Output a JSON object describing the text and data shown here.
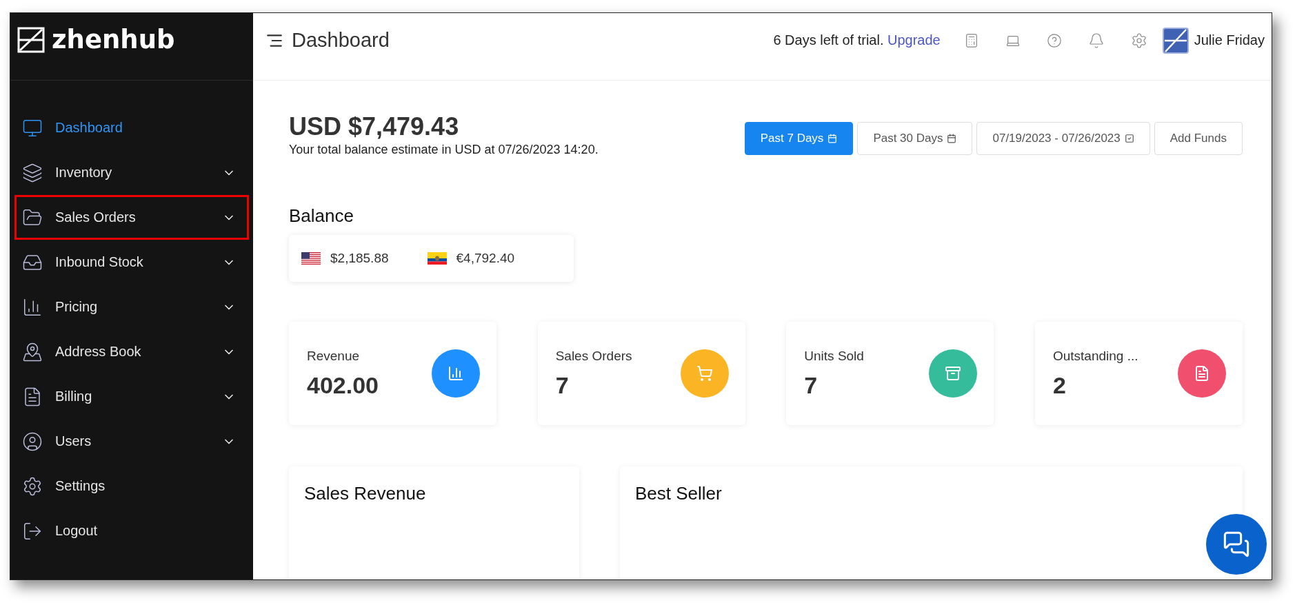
{
  "sidebar": {
    "logo": "zhenhub",
    "items": [
      {
        "label": "Dashboard",
        "selected": true,
        "expandable": false,
        "highlighted": false
      },
      {
        "label": "Inventory",
        "selected": false,
        "expandable": true,
        "highlighted": false
      },
      {
        "label": "Sales Orders",
        "selected": false,
        "expandable": true,
        "highlighted": true
      },
      {
        "label": "Inbound Stock",
        "selected": false,
        "expandable": true,
        "highlighted": false
      },
      {
        "label": "Pricing",
        "selected": false,
        "expandable": true,
        "highlighted": false
      },
      {
        "label": "Address Book",
        "selected": false,
        "expandable": true,
        "highlighted": false
      },
      {
        "label": "Billing",
        "selected": false,
        "expandable": true,
        "highlighted": false
      },
      {
        "label": "Users",
        "selected": false,
        "expandable": true,
        "highlighted": false
      },
      {
        "label": "Settings",
        "selected": false,
        "expandable": false,
        "highlighted": false
      },
      {
        "label": "Logout",
        "selected": false,
        "expandable": false,
        "highlighted": false
      }
    ]
  },
  "header": {
    "title": "Dashboard",
    "trial_text": "6 Days left of trial.",
    "upgrade_link": "Upgrade",
    "user_name": "Julie Friday"
  },
  "summary": {
    "amount": "USD $7,479.43",
    "note": "Your total balance estimate in USD at 07/26/2023 14:20."
  },
  "range_buttons": [
    {
      "label": "Past 7 Days",
      "selected": true,
      "kind": "calendar"
    },
    {
      "label": "Past 30 Days",
      "selected": false,
      "kind": "calendar"
    },
    {
      "label": "07/19/2023 - 07/26/2023",
      "selected": false,
      "kind": "check"
    },
    {
      "label": "Add Funds",
      "selected": false,
      "kind": "plain"
    }
  ],
  "balance": {
    "title": "Balance",
    "entries": [
      {
        "amount": "$2,185.88",
        "kind": "us"
      },
      {
        "amount": "€4,792.40",
        "kind": "ec"
      }
    ]
  },
  "stats": [
    {
      "label": "Revenue",
      "value": "402.00",
      "color": "#1e90ff",
      "kind": "chart"
    },
    {
      "label": "Sales Orders",
      "value": "7",
      "color": "#fbb424",
      "kind": "cart"
    },
    {
      "label": "Units Sold",
      "value": "7",
      "color": "#35bc9b",
      "kind": "archive"
    },
    {
      "label": "Outstanding ...",
      "value": "2",
      "color": "#f0506e",
      "kind": "document"
    }
  ],
  "panels": [
    {
      "title": "Sales Revenue"
    },
    {
      "title": "Best Seller"
    }
  ]
}
